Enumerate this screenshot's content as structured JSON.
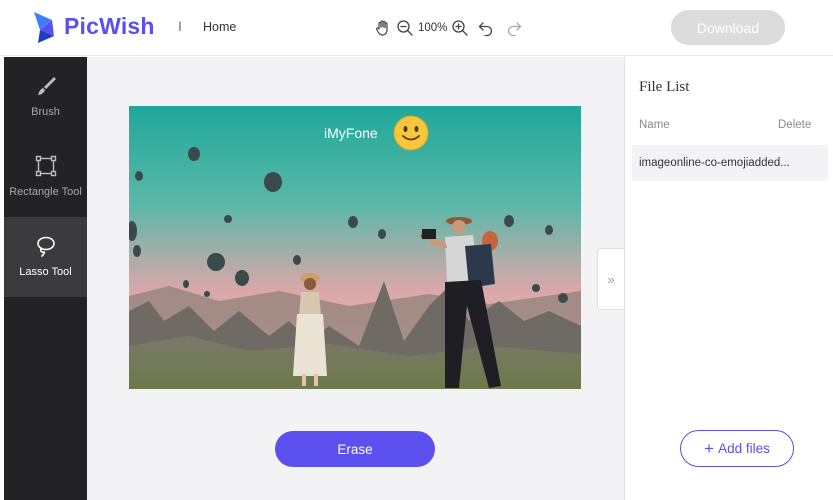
{
  "header": {
    "brand": "PicWish",
    "separator": "I",
    "home_label": "Home",
    "zoom_level": "100%",
    "download_label": "Download",
    "tool_icons": [
      "hand-icon",
      "zoom-out-icon",
      "zoom-in-icon",
      "undo-icon",
      "redo-icon"
    ]
  },
  "sidebar": {
    "items": [
      {
        "label": "Brush",
        "icon": "brush-icon",
        "active": false
      },
      {
        "label": "Rectangle Tool",
        "icon": "rectangle-icon",
        "active": false
      },
      {
        "label": "Lasso Tool",
        "icon": "lasso-icon",
        "active": true
      }
    ]
  },
  "canvas": {
    "watermark_text": "iMyFone",
    "erase_label": "Erase",
    "panel_toggle": "»"
  },
  "file_panel": {
    "title": "File List",
    "col_name": "Name",
    "col_delete": "Delete",
    "files": [
      "imageonline-co-emojiadded..."
    ],
    "add_label": "Add files",
    "add_icon": "+"
  },
  "colors": {
    "accent": "#5b4ff0",
    "sidebar_bg": "#232325",
    "sidebar_active": "#3b3b3d",
    "download_disabled": "#dcdcdc"
  }
}
